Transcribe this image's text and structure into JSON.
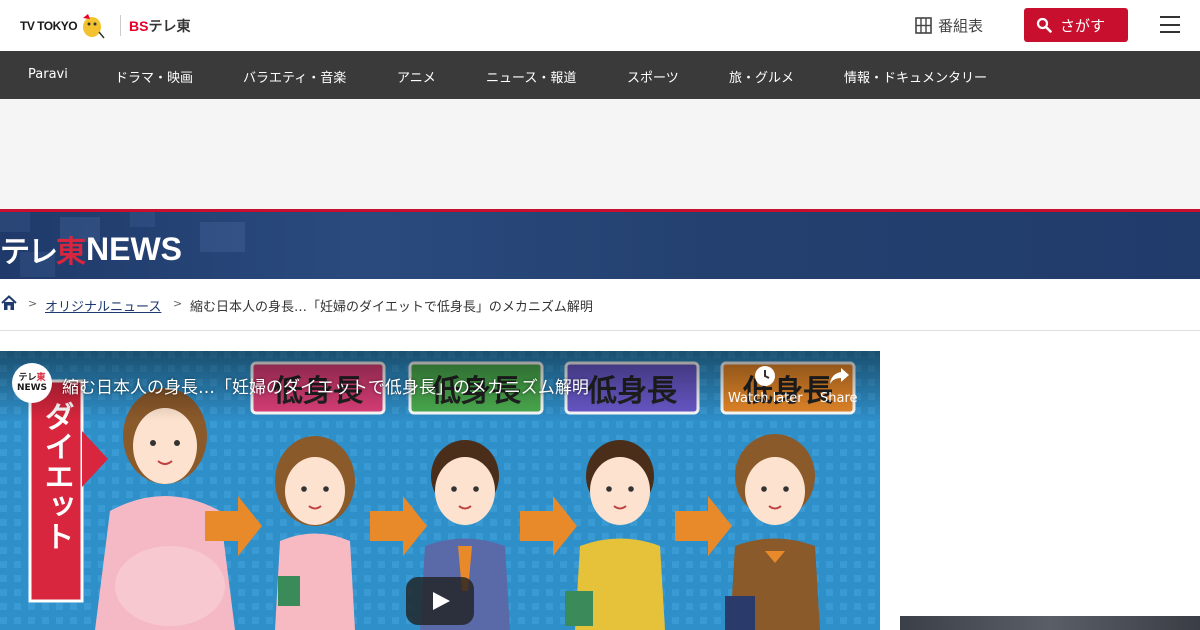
{
  "header": {
    "logo_tvtokyo": "TV TOKYO",
    "logo_bs_prefix": "BS",
    "logo_bs_rest": "テレ東",
    "schedule_label": "番組表",
    "search_label": "さがす"
  },
  "nav": {
    "items": [
      "Paravi",
      "ドラマ・映画",
      "バラエティ・音楽",
      "アニメ",
      "ニュース・報道",
      "スポーツ",
      "旅・グルメ",
      "情報・ドキュメンタリー"
    ]
  },
  "news_banner": {
    "logo_jp_1": "テレ",
    "logo_jp_2": "東",
    "logo_en": "NEWS"
  },
  "breadcrumb": {
    "sep": ">",
    "category": "オリジナルニュース",
    "current": "縮む日本人の身長…「妊婦のダイエットで低身長」のメカニズム解明"
  },
  "player": {
    "avatar_line1_a": "テレ",
    "avatar_line1_b": "東",
    "avatar_line2": "NEWS",
    "title": "縮む日本人の身長…「妊婦のダイエットで低身長」のメカニズム解明",
    "watch_later": "Watch later",
    "share": "Share",
    "slide": {
      "side_label": "ダイエット",
      "tag": "低身長",
      "colors": [
        "#e0407a",
        "#4caf50",
        "#6a5acd",
        "#e8892a"
      ]
    }
  },
  "colors": {
    "brand_red": "#c8102e",
    "nav_bg": "#3a3a3a",
    "banner_bg": "#1f3a6a"
  }
}
